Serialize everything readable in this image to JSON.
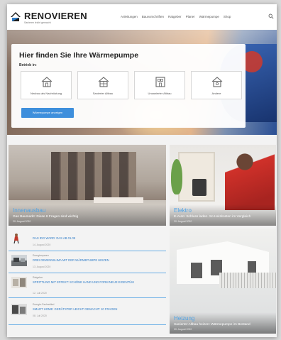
{
  "header": {
    "brand": "RENOVIEREN",
    "tagline": "Sanieren leicht gemacht",
    "nav": [
      "Anleitungen",
      "Bauvorschriften",
      "Ratgeber",
      "Planer",
      "Wärmepumpe",
      "Shop"
    ]
  },
  "hero": {
    "title": "Hier finden Sie Ihre Wärmepumpe",
    "subtitle": "Betrieb in:",
    "options": [
      {
        "label": "Neubau als Nachrüstung",
        "icon": "house-icon"
      },
      {
        "label": "Sanierter Altbau",
        "icon": "house-renovated-icon"
      },
      {
        "label": "Unsanierter Altbau",
        "icon": "house-old-icon"
      },
      {
        "label": "Andere",
        "icon": "house-other-icon"
      }
    ],
    "cta": "Wärmepumpe anzeigen"
  },
  "featured": {
    "main": {
      "category": "Innenausbau",
      "title": "Gas Baumarkt: Diese 8 Fragen sind wichtig",
      "date": "20. August 2020"
    },
    "side1": {
      "category": "Elektro",
      "title": "E-Auto: Schluss laden. So Heizkosten im Vergleich",
      "date": "20. August 2020"
    },
    "side2": {
      "category": "Heizung",
      "title": "Sanierter Altbau heizen: Wärmepumpe im Bestand",
      "date": "20. August 2020"
    }
  },
  "list": [
    {
      "kicker": "",
      "title": "DAS IDG WARD: DAS AB 01.09",
      "date": "14. August 2020"
    },
    {
      "kicker": "Energiesparen",
      "title": "DREI GEWINNSLIMA MIT DER WÄRMEPUMPE HEIZEN",
      "date": "13. August 2020"
    },
    {
      "kicker": "Ratgeber",
      "title": "SPRITTLING MIT EFFEKT: SCHÖNE HAND UND FORM NEUE EIGENTÜM",
      "date": "12. Juli 2020"
    },
    {
      "kicker": "Energie-Fachartikel",
      "title": "SMART HOME: GERÄTSTER LEICHT GEMACHT: 10 FRAGEN",
      "date": "08. Juli 2020"
    }
  ]
}
